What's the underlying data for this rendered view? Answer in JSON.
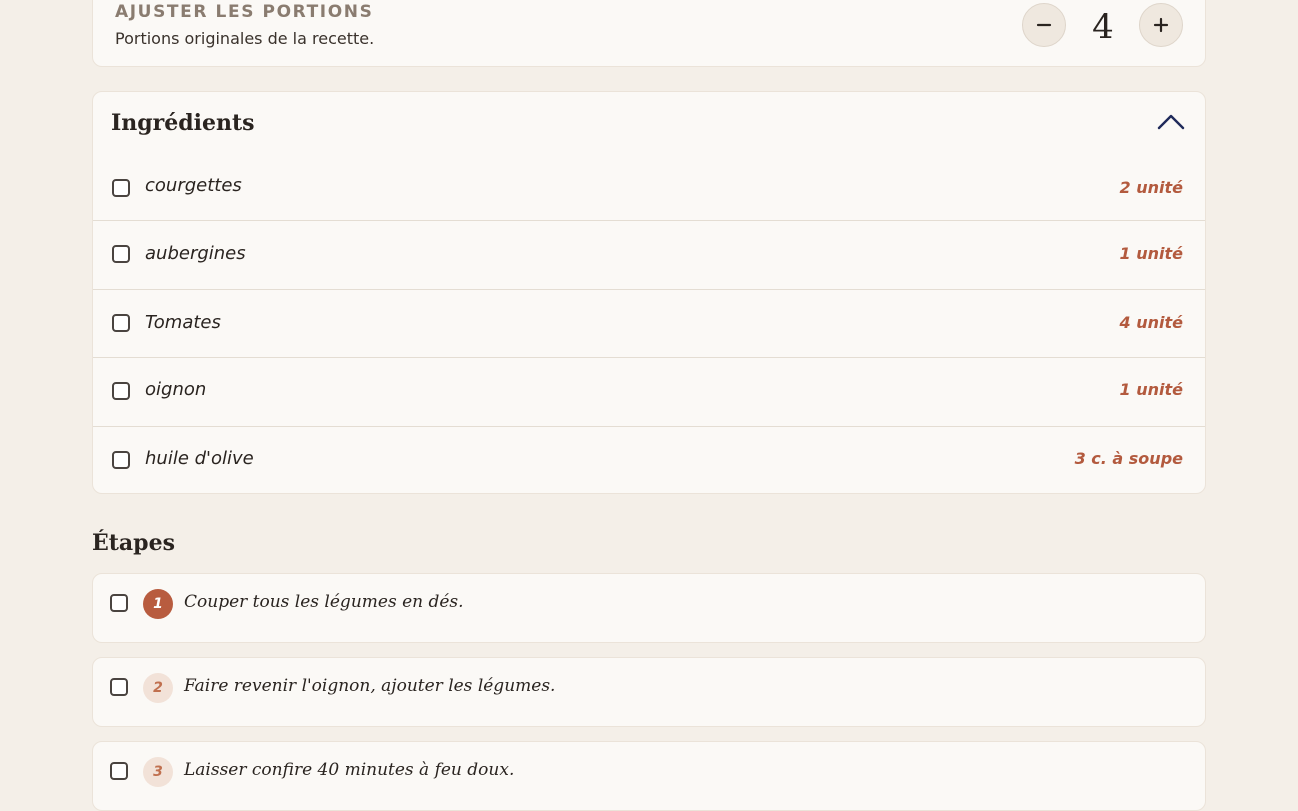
{
  "portions": {
    "title": "AJUSTER LES PORTIONS",
    "subtitle": "Portions originales de la recette.",
    "count": "4",
    "minus_icon": "minus-icon",
    "plus_icon": "plus-icon"
  },
  "ingredients": {
    "title": "Ingrédients",
    "toggle_icon": "chevron-up-icon",
    "items": [
      {
        "name": "courgettes",
        "qty": "2 unité"
      },
      {
        "name": "aubergines",
        "qty": "1 unité"
      },
      {
        "name": "Tomates",
        "qty": "4 unité"
      },
      {
        "name": "oignon",
        "qty": "1 unité"
      },
      {
        "name": "huile d'olive",
        "qty": "3 c. à soupe"
      }
    ]
  },
  "steps": {
    "title": "Étapes",
    "items": [
      {
        "number": "1",
        "text": "Couper tous les légumes en dés.",
        "active": true
      },
      {
        "number": "2",
        "text": "Faire revenir l'oignon, ajouter les légumes.",
        "active": false
      },
      {
        "number": "3",
        "text": "Laisser confire 40 minutes à feu doux.",
        "active": false
      }
    ]
  },
  "colors": {
    "background": "#f4efe8",
    "accent": "#b85c3f",
    "quantity": "#b35a3e"
  }
}
